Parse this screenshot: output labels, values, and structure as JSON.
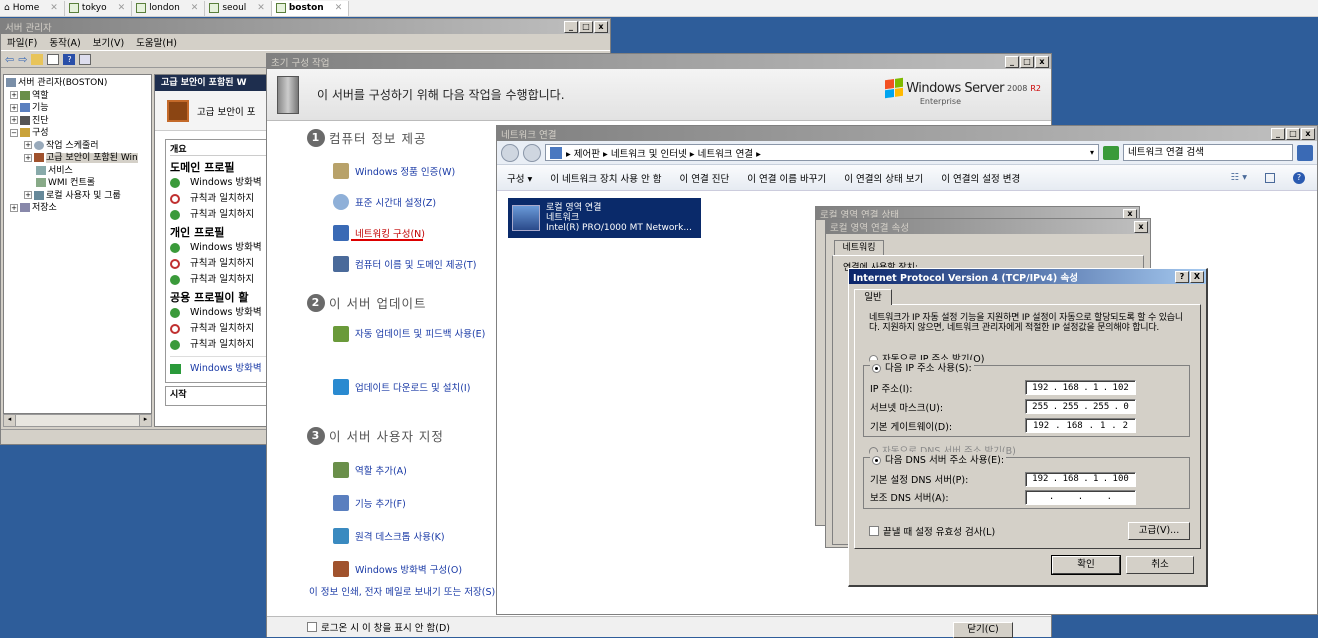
{
  "tabs": [
    {
      "label": "Home"
    },
    {
      "label": "tokyo"
    },
    {
      "label": "london"
    },
    {
      "label": "seoul"
    },
    {
      "label": "boston",
      "active": true
    }
  ],
  "server_manager": {
    "title": "서버 관리자",
    "menu": [
      "파일(F)",
      "동작(A)",
      "보기(V)",
      "도움말(H)"
    ],
    "tree": [
      {
        "label": "서버 관리자(BOSTON)",
        "indent": 0
      },
      {
        "label": "역할",
        "indent": 1
      },
      {
        "label": "기능",
        "indent": 1
      },
      {
        "label": "진단",
        "indent": 1
      },
      {
        "label": "구성",
        "indent": 1
      },
      {
        "label": "작업 스케줄러",
        "indent": 2
      },
      {
        "label": "고급 보안이 포함된 Win",
        "indent": 2,
        "selected": true
      },
      {
        "label": "서비스",
        "indent": 2
      },
      {
        "label": "WMI 컨트롤",
        "indent": 2
      },
      {
        "label": "로컬 사용자 및 그룹",
        "indent": 2
      },
      {
        "label": "저장소",
        "indent": 0
      }
    ],
    "panel_header": "고급 보안이 포함된 W",
    "panel_banner": "고급 보안이 포",
    "overview_label": "개요",
    "profiles": [
      {
        "title": "도메인 프로필",
        "rows": [
          {
            "status": "ok",
            "text": "Windows 방화벽"
          },
          {
            "status": "block",
            "text": "규칙과 일치하지"
          },
          {
            "status": "ok",
            "text": "규칙과 일치하지"
          }
        ]
      },
      {
        "title": "개인 프로필",
        "rows": [
          {
            "status": "ok",
            "text": "Windows 방화벽"
          },
          {
            "status": "block",
            "text": "규칙과 일치하지"
          },
          {
            "status": "ok",
            "text": "규칙과 일치하지"
          }
        ]
      },
      {
        "title": "공용 프로필이 활",
        "rows": [
          {
            "status": "ok",
            "text": "Windows 방화벽"
          },
          {
            "status": "block",
            "text": "규칙과 일치하지"
          },
          {
            "status": "ok",
            "text": "규칙과 일치하지"
          }
        ]
      }
    ],
    "firewall_link": "Windows 방화벽",
    "start_label": "시작"
  },
  "ict": {
    "title": "초기 구성 작업",
    "header": "이 서버를 구성하기 위해 다음 작업을 수행합니다.",
    "brand": "Windows Server",
    "brand_version": "2008",
    "brand_r2": "R2",
    "brand_edition": "Enterprise",
    "sections": [
      {
        "num": "1",
        "title": "컴퓨터 정보 제공",
        "items": [
          "Windows 정품 인증(W)",
          "표준 시간대 설정(Z)",
          "네트워킹 구성(N)",
          "컴퓨터 이름 및 도메인 제공(T)"
        ]
      },
      {
        "num": "2",
        "title": "이 서버 업데이트",
        "items": [
          "자동 업데이트 및 피드백 사용(E)",
          "업데이트 다운로드 및 설치(I)"
        ]
      },
      {
        "num": "3",
        "title": "이 서버 사용자 지정",
        "items": [
          "역할 추가(A)",
          "기능 추가(F)",
          "원격 데스크톱 사용(K)",
          "Windows 방화벽 구성(O)"
        ]
      }
    ],
    "print_link": "이 정보 인쇄, 전자 메일로 보내기 또는 저장(S)",
    "dont_show": "로그온 시 이 창을 표시 안 함(D)",
    "close_button": "닫기(C)"
  },
  "netconn": {
    "title": "네트워크 연결",
    "breadcrumb": "▸ 제어판 ▸ 네트워크 및 인터넷 ▸ 네트워크 연결 ▸",
    "search_placeholder": "네트워크 연결 검색",
    "toolbar": [
      "구성 ▾",
      "이 네트워크 장치 사용 안 함",
      "이 연결 진단",
      "이 연결 이름 바꾸기",
      "이 연결의 상태 보기",
      "이 연결의 설정 변경"
    ],
    "adapter": {
      "name": "로컬 영역 연결",
      "network": "네트워크",
      "device": "Intel(R) PRO/1000 MT Network..."
    }
  },
  "status_dlg": {
    "title": "로컬 영역 연결 상태"
  },
  "props_dlg": {
    "title": "로컬 영역 연결 속성",
    "tab": "네트워킹",
    "connect_using": "연결에 사용할 장치:"
  },
  "ipv4": {
    "title": "Internet Protocol Version 4 (TCP/IPv4) 속성",
    "help": "?",
    "close": "X",
    "tab": "일반",
    "desc": "네트워크가 IP 자동 설정 기능을 지원하면 IP 설정이 자동으로 할당되도록 할 수 있습니다. 지원하지 않으면, 네트워크 관리자에게 적절한 IP 설정값을 문의해야 합니다.",
    "auto_ip": "자동으로 IP 주소 받기(O)",
    "manual_ip": "다음 IP 주소 사용(S):",
    "ip_label": "IP 주소(I):",
    "ip": [
      "192",
      "168",
      "1",
      "102"
    ],
    "mask_label": "서브넷 마스크(U):",
    "mask": [
      "255",
      "255",
      "255",
      "0"
    ],
    "gw_label": "기본 게이트웨이(D):",
    "gw": [
      "192",
      "168",
      "1",
      "2"
    ],
    "auto_dns": "자동으로 DNS 서버 주소 받기(B)",
    "manual_dns": "다음 DNS 서버 주소 사용(E):",
    "dns1_label": "기본 설정 DNS 서버(P):",
    "dns1": [
      "192",
      "168",
      "1",
      "100"
    ],
    "dns2_label": "보조 DNS 서버(A):",
    "validate": "끝낼 때 설정 유효성 검사(L)",
    "advanced": "고급(V)...",
    "ok": "확인",
    "cancel": "취소"
  },
  "colors": {
    "title_active": "#0a246a",
    "link": "#1a3aa6",
    "desktop": "#2e5d9a"
  }
}
